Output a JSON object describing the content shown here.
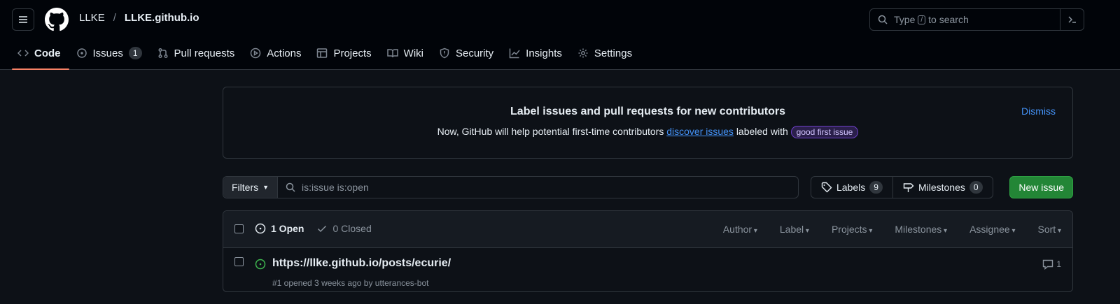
{
  "header": {
    "owner": "LLKE",
    "separator": "/",
    "repo": "LLKE.github.io",
    "search_placeholder_pre": "Type",
    "search_kbd": "/",
    "search_placeholder_post": "to search"
  },
  "tabs": [
    {
      "label": "Code",
      "icon": "code-icon",
      "active": true
    },
    {
      "label": "Issues",
      "icon": "issue-opened-icon",
      "count": "1"
    },
    {
      "label": "Pull requests",
      "icon": "git-pull-request-icon"
    },
    {
      "label": "Actions",
      "icon": "play-icon"
    },
    {
      "label": "Projects",
      "icon": "table-icon"
    },
    {
      "label": "Wiki",
      "icon": "book-icon"
    },
    {
      "label": "Security",
      "icon": "shield-icon"
    },
    {
      "label": "Insights",
      "icon": "graph-icon"
    },
    {
      "label": "Settings",
      "icon": "gear-icon"
    }
  ],
  "banner": {
    "title": "Label issues and pull requests for new contributors",
    "desc_pre": "Now, GitHub will help potential first-time contributors",
    "desc_link": "discover issues",
    "desc_post": "labeled with",
    "label": "good first issue",
    "dismiss": "Dismiss"
  },
  "filters": {
    "button": "Filters",
    "query": "is:issue is:open",
    "labels_label": "Labels",
    "labels_count": "9",
    "milestones_label": "Milestones",
    "milestones_count": "0",
    "new_issue": "New issue"
  },
  "list": {
    "open": "1 Open",
    "closed": "0 Closed",
    "menus": [
      "Author",
      "Label",
      "Projects",
      "Milestones",
      "Assignee",
      "Sort"
    ]
  },
  "issues": [
    {
      "title": "https://llke.github.io/posts/ecurie/",
      "meta": "#1 opened 3 weeks ago by utterances-bot",
      "comments": "1"
    }
  ],
  "colors": {
    "accent_underline": "#f78166",
    "link": "#4493f8",
    "open_green": "#3fb950",
    "new_issue_bg": "#238636"
  }
}
